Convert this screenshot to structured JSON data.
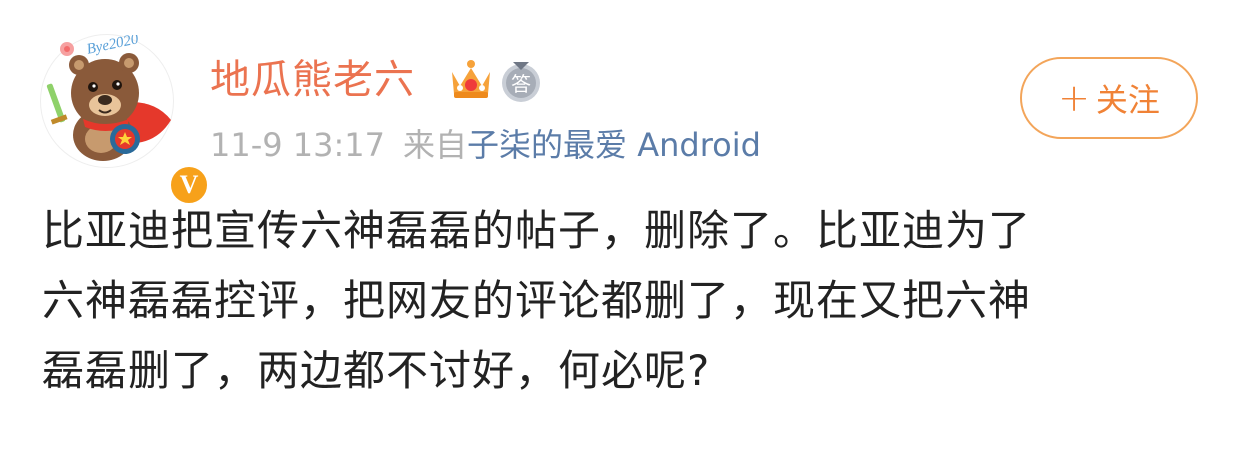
{
  "user": {
    "name": "地瓜熊老六",
    "avatar_icon": "bear-mascot-icon",
    "avatar_sign_text": "Bye2020",
    "verified_badge": "V",
    "crown_icon": "crown-icon",
    "medal_icon": "answer-medal-icon",
    "medal_text": "答"
  },
  "meta": {
    "time": "11-9 13:17",
    "from_label": "来自",
    "source": "子柒的最爱 Android"
  },
  "follow": {
    "plus": "+",
    "label": "关注"
  },
  "content": {
    "lines": [
      "比亚迪把宣传六神磊磊的帖子，删除了。比亚迪为了",
      "六神磊磊控评，把网友的评论都删了，现在又把六神",
      "磊磊删了，两边都不讨好，何必呢?"
    ]
  },
  "colors": {
    "username": "#eb7350",
    "meta": "#b2b2b2",
    "source": "#5b7ca8",
    "follow_border": "#f3a55a",
    "follow_text": "#f08236",
    "text": "#222222",
    "badge": "#f7a11a"
  }
}
